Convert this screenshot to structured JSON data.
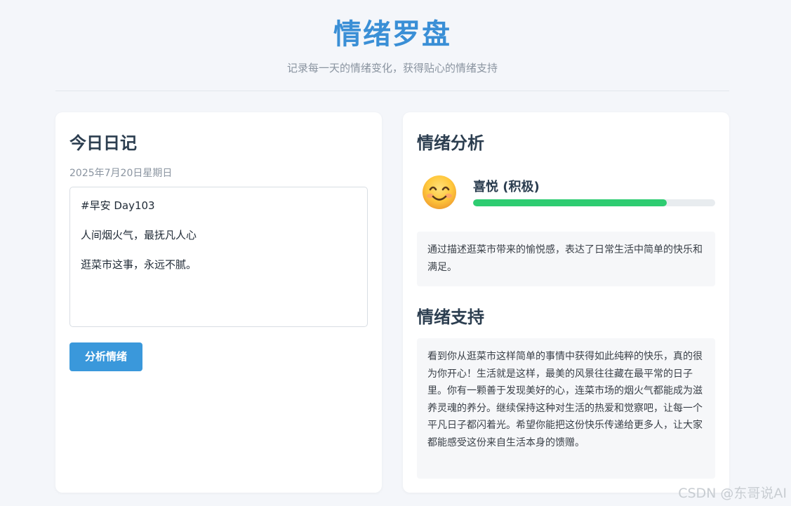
{
  "header": {
    "title": "情绪罗盘",
    "subtitle": "记录每一天的情绪变化，获得贴心的情绪支持"
  },
  "diary": {
    "title": "今日日记",
    "date": "2025年7月20日星期日",
    "lines": [
      "#早安 Day103",
      "人间烟火气，最抚凡人心",
      "逛菜市这事，永远不腻。"
    ],
    "analyze_button": "分析情绪"
  },
  "analysis": {
    "title": "情绪分析",
    "emoji_icon": "smiling-face-icon",
    "emotion": "喜悦 (积极)",
    "score_fraction": 0.8,
    "bar_color": "#2ecc71",
    "summary": "通过描述逛菜市带来的愉悦感，表达了日常生活中简单的快乐和满足。"
  },
  "support": {
    "title": "情绪支持",
    "text": "看到你从逛菜市这样简单的事情中获得如此纯粹的快乐，真的很为你开心！生活就是这样，最美的风景往往藏在最平常的日子里。你有一颗善于发现美好的心，连菜市场的烟火气都能成为滋养灵魂的养分。继续保持这种对生活的热爱和觉察吧，让每一个平凡日子都闪着光。希望你能把这份快乐传递给更多人，让大家都能感受这份来自生活本身的馈赠。"
  },
  "watermark": "CSDN @东哥说AI",
  "colors": {
    "accent": "#3a8fd6",
    "button": "#3a98db",
    "positive": "#2ecc71"
  }
}
